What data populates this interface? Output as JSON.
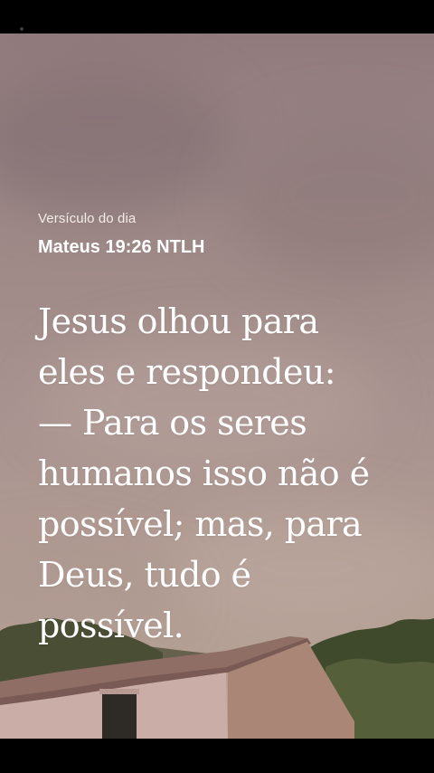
{
  "verse": {
    "label": "Versículo do dia",
    "reference": "Mateus 19:26 NTLH",
    "text": "Jesus olhou para\neles e respondeu:\n— Para os seres\nhumanos isso não é\npossível; mas, para\nDeus, tudo é\npossível."
  },
  "colors": {
    "text": "#ffffff",
    "sky": "#a08b88",
    "bars": "#000000"
  }
}
